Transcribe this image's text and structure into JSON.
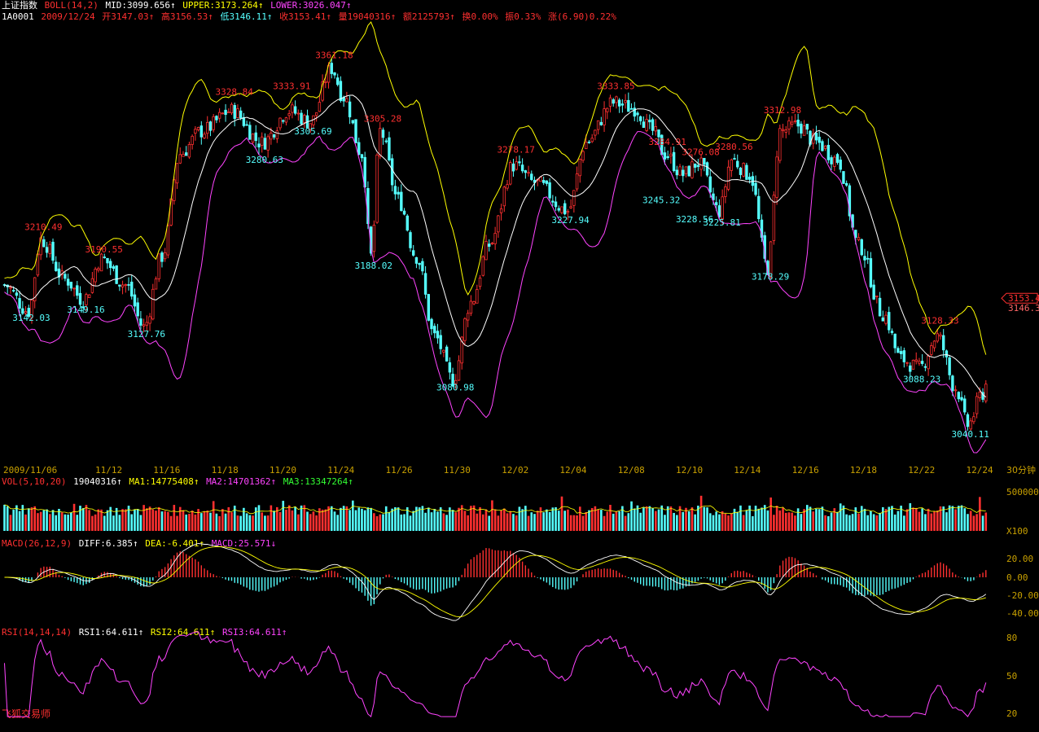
{
  "header": {
    "index_name": "上证指数",
    "boll_label": "BOLL(14,2)",
    "mid": "MID:3099.656↑",
    "upper": "UPPER:3173.264↑",
    "lower": "LOWER:3026.047↑",
    "code": "1A0001",
    "date": "2009/12/24",
    "open": "开3147.03↑",
    "high": "高3156.53↑",
    "low": "低3146.11↑",
    "close": "收3153.41↑",
    "volume": "量19040316↑",
    "amount": "额2125793↑",
    "turnover": "换0.00%",
    "amplitude": "振0.33%",
    "change": "涨(6.90)0.22%"
  },
  "price_panel": {
    "current_price": "3153.4",
    "last_value": "3146.3",
    "high_labels": [
      {
        "value": "3210.49",
        "bar": 12
      },
      {
        "value": "3190.55",
        "bar": 32
      },
      {
        "value": "3328.84",
        "bar": 75
      },
      {
        "value": "3333.91",
        "bar": 94
      },
      {
        "value": "3361.18",
        "bar": 108
      },
      {
        "value": "3305.28",
        "bar": 124
      },
      {
        "value": "3278.17",
        "bar": 168
      },
      {
        "value": "3333.85",
        "bar": 201
      },
      {
        "value": "3284.91",
        "bar": 218
      },
      {
        "value": "3276.08",
        "bar": 229
      },
      {
        "value": "3280.56",
        "bar": 240
      },
      {
        "value": "3312.98",
        "bar": 256
      },
      {
        "value": "3128.33",
        "bar": 308
      }
    ],
    "low_labels": [
      {
        "value": "3142.03",
        "bar": 8
      },
      {
        "value": "3149.16",
        "bar": 26
      },
      {
        "value": "3127.76",
        "bar": 46
      },
      {
        "value": "3280.63",
        "bar": 85
      },
      {
        "value": "3305.69",
        "bar": 101
      },
      {
        "value": "3188.02",
        "bar": 121
      },
      {
        "value": "3080.98",
        "bar": 148
      },
      {
        "value": "3227.94",
        "bar": 186
      },
      {
        "value": "3245.32",
        "bar": 216
      },
      {
        "value": "3228.56",
        "bar": 227
      },
      {
        "value": "3225.81",
        "bar": 236
      },
      {
        "value": "3178.29",
        "bar": 252
      },
      {
        "value": "3088.23",
        "bar": 302
      },
      {
        "value": "3040.11",
        "bar": 318
      }
    ]
  },
  "date_axis": {
    "labels": [
      "2009/11/06",
      "11/12",
      "11/16",
      "11/18",
      "11/20",
      "11/24",
      "11/26",
      "11/30",
      "12/02",
      "12/04",
      "12/08",
      "12/10",
      "12/14",
      "12/16",
      "12/18",
      "12/22",
      "12/24"
    ],
    "period": "30分钟"
  },
  "vol_panel": {
    "label": "VOL(5,10,20)",
    "value": "19040316↑",
    "ma1": "MA1:14775408↑",
    "ma2": "MA2:14701362↑",
    "ma3": "MA3:13347264↑",
    "scale_top": "500000",
    "unit": "X100"
  },
  "macd_panel": {
    "label": "MACD(26,12,9)",
    "diff": "DIFF:6.385↑",
    "dea": "DEA:-6.401↑",
    "macd": "MACD:25.571↓",
    "scale": [
      "20.00",
      "0.00",
      "-20.00",
      "-40.00"
    ]
  },
  "rsi_panel": {
    "label": "RSI(14,14,14)",
    "rsi1": "RSI1:64.611↑",
    "rsi2": "RSI2:64.611↑",
    "rsi3": "RSI3:64.611↑",
    "scale": [
      "80",
      "50",
      "20"
    ]
  },
  "brand": "飞狐交易师",
  "colors": {
    "background": "#000000",
    "up": "#ff3030",
    "down": "#55ffff",
    "boll_upper": "#ffff00",
    "boll_mid": "#ffffff",
    "boll_lower": "#ff44ff"
  }
}
